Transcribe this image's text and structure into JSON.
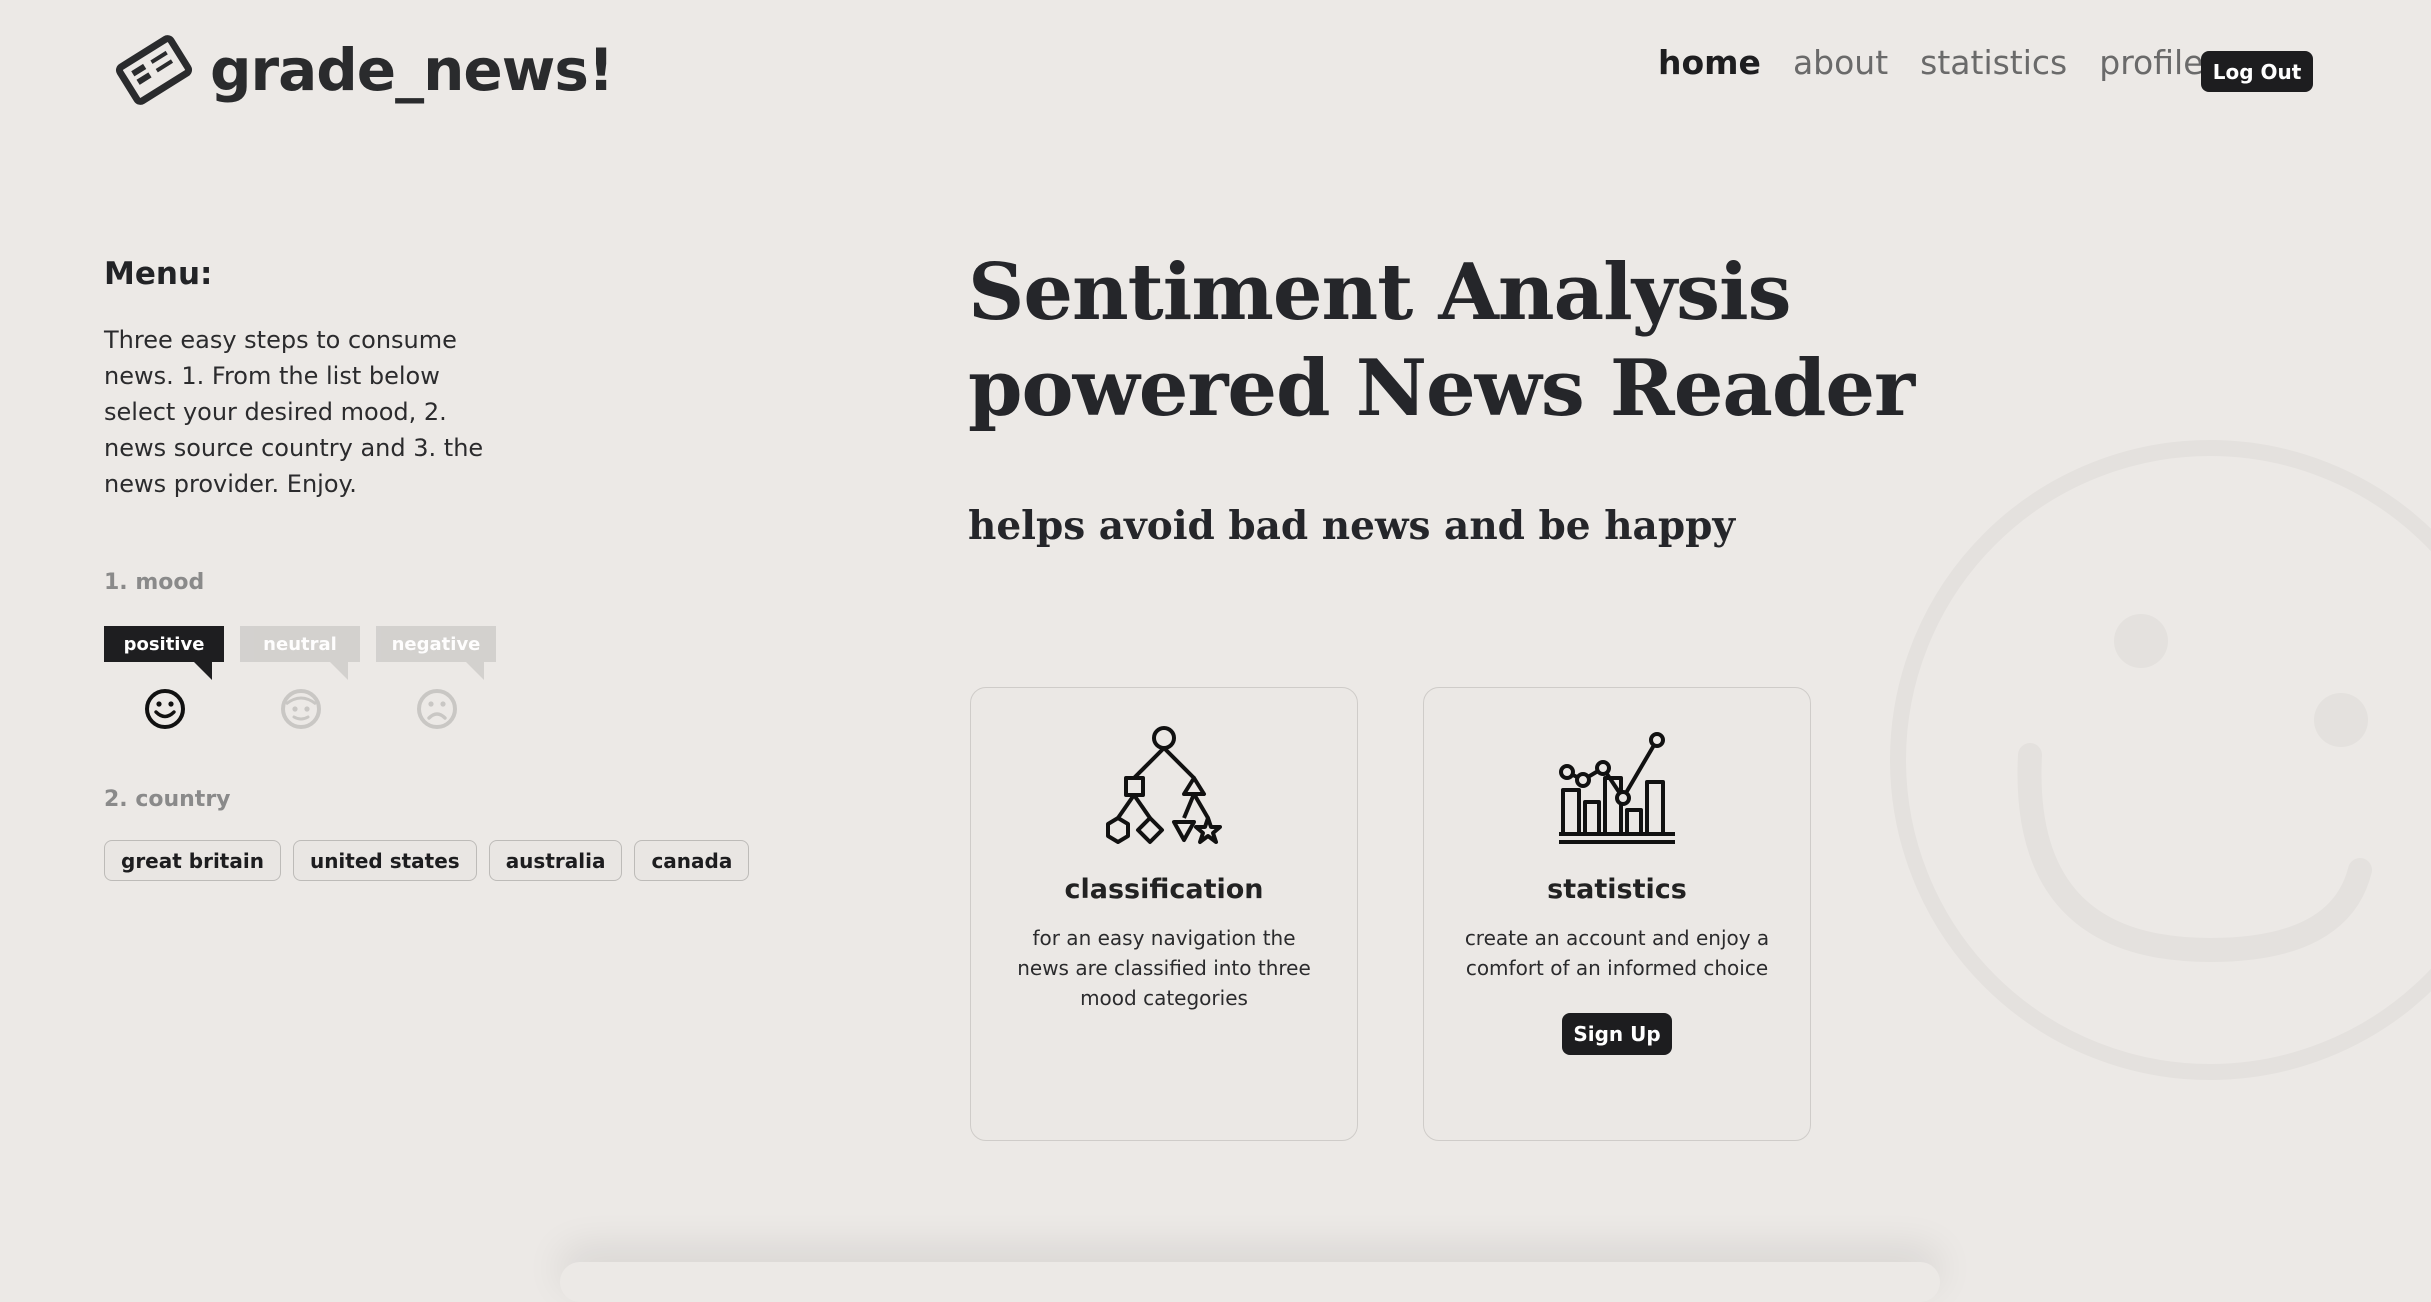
{
  "header": {
    "logo_text": "grade_news!",
    "nav": [
      {
        "label": "home",
        "active": true
      },
      {
        "label": "about",
        "active": false
      },
      {
        "label": "statistics",
        "active": false
      },
      {
        "label": "profile",
        "active": false
      }
    ],
    "logout_label": "Log Out"
  },
  "menu": {
    "title": "Menu:",
    "description": "Three easy steps to consume news. 1. From the list below select your desired mood, 2. news source country and 3. the news provider. Enjoy.",
    "mood_label": "1. mood",
    "moods": [
      {
        "label": "positive",
        "icon": "smile-icon",
        "selected": true
      },
      {
        "label": "neutral",
        "icon": "neutral-face-icon",
        "selected": false
      },
      {
        "label": "negative",
        "icon": "frown-icon",
        "selected": false
      }
    ],
    "country_label": "2. country",
    "countries": [
      "great britain",
      "united states",
      "australia",
      "canada"
    ]
  },
  "hero": {
    "title_line1": "Sentiment Analysis",
    "title_line2": "powered News Reader",
    "subtitle": "helps avoid bad news and be happy"
  },
  "cards": [
    {
      "icon": "classification-tree-icon",
      "title": "classification",
      "text": "for an easy navigation the news are classified into three mood categories"
    },
    {
      "icon": "bar-line-chart-icon",
      "title": "statistics",
      "text": "create an account and enjoy a comfort of an informed choice",
      "button_label": "Sign Up"
    }
  ],
  "colors": {
    "background": "#ece9e6",
    "dark": "#1d1d1f",
    "muted": "#8a8a8a"
  }
}
